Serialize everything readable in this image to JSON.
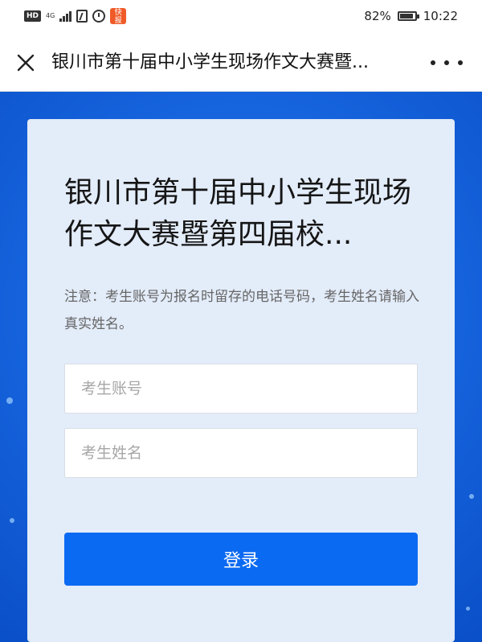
{
  "status_bar": {
    "hd": "HD",
    "network": "4G",
    "app_badge": "快报",
    "battery": "82%",
    "time": "10:22"
  },
  "nav": {
    "title": "银川市第十届中小学生现场作文大赛暨...",
    "close_icon": "close-icon",
    "more_icon": "more-icon"
  },
  "login": {
    "heading": "银川市第十届中小学生现场作文大赛暨第四届校...",
    "notice": "注意：考生账号为报名时留存的电话号码，考生姓名请输入真实姓名。",
    "account_placeholder": "考生账号",
    "name_placeholder": "考生姓名",
    "button_label": "登录"
  },
  "colors": {
    "primary_button": "#0b6af2",
    "card_background": "#e3ecf9",
    "page_background": "#1766e0"
  }
}
